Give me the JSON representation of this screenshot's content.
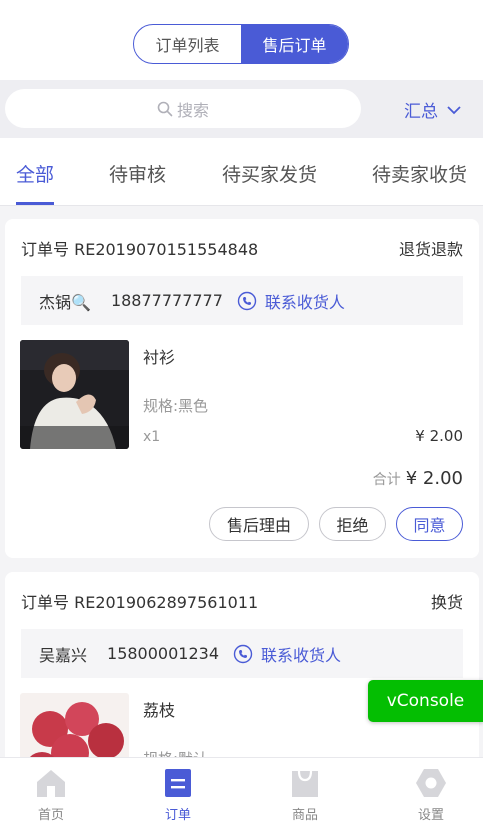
{
  "segment": {
    "items": [
      "订单列表",
      "售后订单"
    ],
    "active_index": 1
  },
  "search": {
    "placeholder": "搜索"
  },
  "summary_label": "汇总",
  "tabs": [
    {
      "label": "全部",
      "active": true
    },
    {
      "label": "待审核",
      "active": false
    },
    {
      "label": "待买家发货",
      "active": false
    },
    {
      "label": "待卖家收货",
      "active": false
    }
  ],
  "orders": [
    {
      "order_label": "订单号 RE2019070151554848",
      "status": "退货退款",
      "contact_name": "杰锅🔍",
      "contact_phone": "18877777777",
      "contact_link": "联系收货人",
      "product_name": "衬衫",
      "product_spec": "规格:黑色",
      "product_qty": "x1",
      "product_price": "¥ 2.00",
      "total_label": "合计",
      "total_amount": "¥ 2.00",
      "buttons": [
        "售后理由",
        "拒绝",
        "同意"
      ]
    },
    {
      "order_label": "订单号 RE2019062897561011",
      "status": "换货",
      "contact_name": "吴嘉兴",
      "contact_phone": "15800001234",
      "contact_link": "联系收货人",
      "product_name": "荔枝",
      "product_spec": "规格:默认"
    }
  ],
  "vconsole_label": "vConsole",
  "tabbar": [
    {
      "label": "首页",
      "icon": "home-icon",
      "active": false
    },
    {
      "label": "订单",
      "icon": "order-icon",
      "active": true
    },
    {
      "label": "商品",
      "icon": "bag-icon",
      "active": false
    },
    {
      "label": "设置",
      "icon": "settings-icon",
      "active": false
    }
  ],
  "colors": {
    "accent": "#4a5bd6",
    "vconsole": "#04be02",
    "background": "#f4f4f6"
  }
}
